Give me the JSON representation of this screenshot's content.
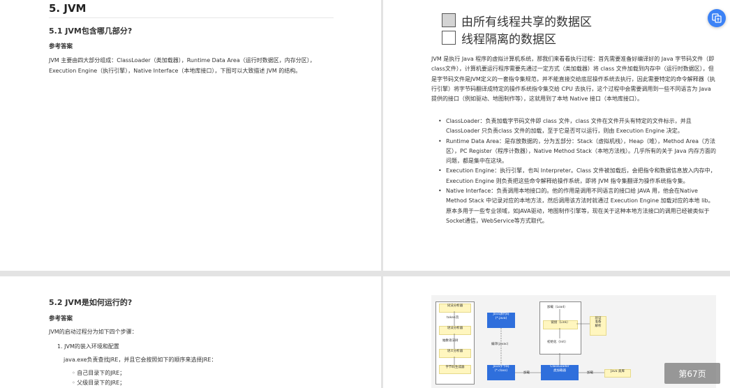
{
  "page1": {
    "chapter_title": "5. JVM",
    "section_title": "5.1 JVM包含哪几部分?",
    "answer_label": "参考答案",
    "intro": "JVM 主要由四大部分组成：ClassLoader（类加载器），Runtime Data Area（运行时数据区，内存分区），Execution Engine（执行引擎），Native Interface（本地库接口），下图可以大致描述 JVM 的结构。"
  },
  "page2": {
    "legend": [
      {
        "label": "由所有线程共享的数据区",
        "color": "#d4d4d4"
      },
      {
        "label": "线程隔离的数据区",
        "color": "#ffffff"
      }
    ],
    "paragraph": "JVM 是执行 Java 程序的虚拟计算机系统，那我们来看看执行过程：首先需要准备好编译好的 Java 字节码文件（即class文件），计算机要运行程序需要先通过一定方式（类加载器）将 class 文件加载到内存中（运行时数据区），但是字节码文件是JVM定义的一套指令集规范，并不能直接交给底层操作系统去执行，因此需要特定的命令解释器（执行引擎）将字节码翻译成特定的操作系统指令集交给 CPU 去执行，这个过程中会需要调用到一些不同语言为 Java 提供的接口（例如驱动、地图制作等），这就用到了本地 Native 接口（本地库接口）。",
    "bullets": [
      "ClassLoader：负责加载字节码文件即 class 文件，class 文件在文件开头有特定的文件标示，并且ClassLoader 只负责class 文件的加载，至于它是否可以运行，则由 Execution Engine 决定。",
      "Runtime Data Area：是存放数据的，分为五部分：Stack（虚拟机栈），Heap（堆），Method Area（方法区），PC Register（程序计数器），Native Method Stack（本地方法栈）。几乎所有的关于 Java 内存方面的问题，都是集中在这块。",
      "Execution Engine：执行引擎，也叫 Interpreter。Class 文件被加载后，会把指令和数据信息放入内存中，Execution Engine 则负责把这些命令解释给操作系统，即将 JVM 指令集翻译为操作系统指令集。",
      "Native Interface：负责调用本地接口的。他的作用是调用不同语言的接口给 JAVA 用，他会在Native Method Stack 中记录对应的本地方法，然后调用该方法时就通过 Execution Engine 加载对应的本地 lib。原本多用于一些专业领域，如JAVA驱动，地图制作引擎等，现在关于这种本地方法接口的调用已经被类似于Socket通信，WebService等方式取代。"
    ]
  },
  "page3": {
    "section_title": "5.2 JVM是如何运行的?",
    "answer_label": "参考答案",
    "intro": "JVM的启动过程分为如下四个步骤：",
    "step1": "1. JVM的装入环境和配置",
    "step1_desc": "java.exe负责查找JRE，并且它会按照如下的顺序来选择JRE：",
    "sub_items": [
      "自己目录下的JRE；",
      "父级目录下的JRE；"
    ]
  },
  "page4_diagram": {
    "lexer": "词法分析器",
    "token": "token流",
    "parser": "语法分析器",
    "ast": "抽象语法树",
    "semantic": "语义分析器",
    "bytecode_gen": "字节码生成器",
    "java_source": "Java源代码\n(*.java)",
    "compile": "编译(javac)",
    "java_class": "Java字节码\n(*.class)",
    "load_arrow": "加载",
    "load": "加载（Load）",
    "link": "链接（Link）",
    "init": "初始化（Init）",
    "verify": "验证\n准备\n解析",
    "classloader": "ClassLoader\n类加载器",
    "load_arrow2": "加载",
    "java_lib": "Java 类库"
  },
  "page_indicator": "第67页",
  "colors": {
    "accent": "#3b82f6",
    "diagram_blue": "#2f6fdc",
    "note_yellow": "#fff6bf"
  }
}
